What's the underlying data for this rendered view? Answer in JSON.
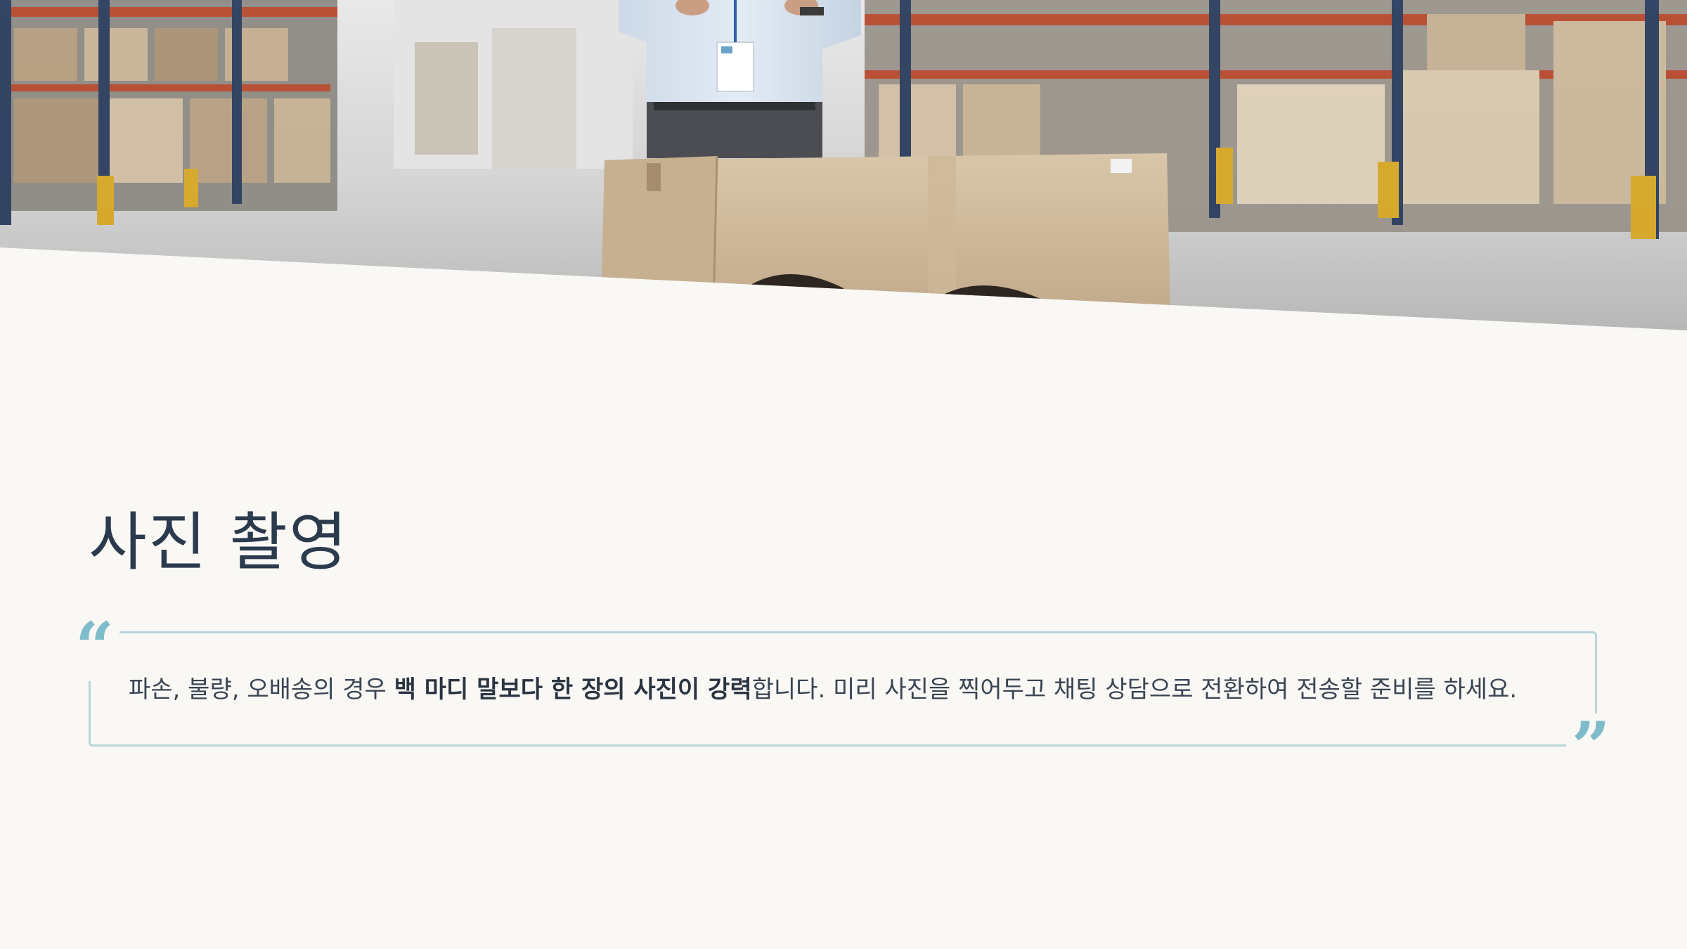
{
  "slide": {
    "title": "사진 촬영",
    "quote": {
      "open_mark": "“",
      "close_mark": "”",
      "text_before": "파손, 불량, 오배송의 경우 ",
      "text_bold": "백 마디 말보다 한 장의 사진이 강력",
      "text_after": "합니다. 미리 사진을 찍어두고 채팅 상담으로 전환하여 전송할 준비를 하세요."
    },
    "hero_image": {
      "icon": "warehouse-photo",
      "description_visible": false
    },
    "colors": {
      "background": "#f9f8f5",
      "title": "#2b3a4d",
      "quote_border": "#b9d4db",
      "quote_marks": "#7fbcca",
      "body_text": "#3a4553"
    }
  }
}
